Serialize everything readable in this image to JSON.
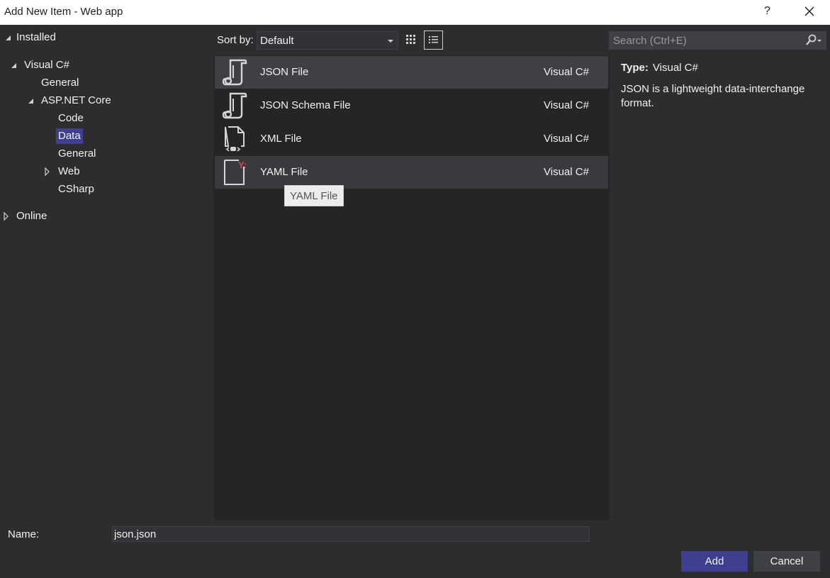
{
  "window": {
    "title": "Add New Item - Web app",
    "help": "?"
  },
  "tree": {
    "installed": "Installed",
    "visual_csharp": "Visual C#",
    "general1": "General",
    "aspnet_core": "ASP.NET Core",
    "code": "Code",
    "data": "Data",
    "general2": "General",
    "web": "Web",
    "csharp": "CSharp",
    "online": "Online"
  },
  "toolbar": {
    "sort_label": "Sort by:",
    "sort_value": "Default"
  },
  "search": {
    "placeholder": "Search (Ctrl+E)"
  },
  "templates": [
    {
      "name": "JSON File",
      "lang": "Visual C#",
      "icon": "json-file-icon"
    },
    {
      "name": "JSON Schema File",
      "lang": "Visual C#",
      "icon": "json-schema-file-icon"
    },
    {
      "name": "XML File",
      "lang": "Visual C#",
      "icon": "xml-file-icon"
    },
    {
      "name": "YAML File",
      "lang": "Visual C#",
      "icon": "yaml-file-icon"
    }
  ],
  "tooltip": "YAML File",
  "details": {
    "type_label": "Type:",
    "type_value": "Visual C#",
    "description": "JSON is a lightweight data-interchange format."
  },
  "footer": {
    "name_label": "Name:",
    "name_value": "json.json",
    "add": "Add",
    "cancel": "Cancel"
  },
  "colors": {
    "accent": "#3f3f8f",
    "selected_row": "#3f3f46",
    "yaml_accent": "#e0404a"
  }
}
